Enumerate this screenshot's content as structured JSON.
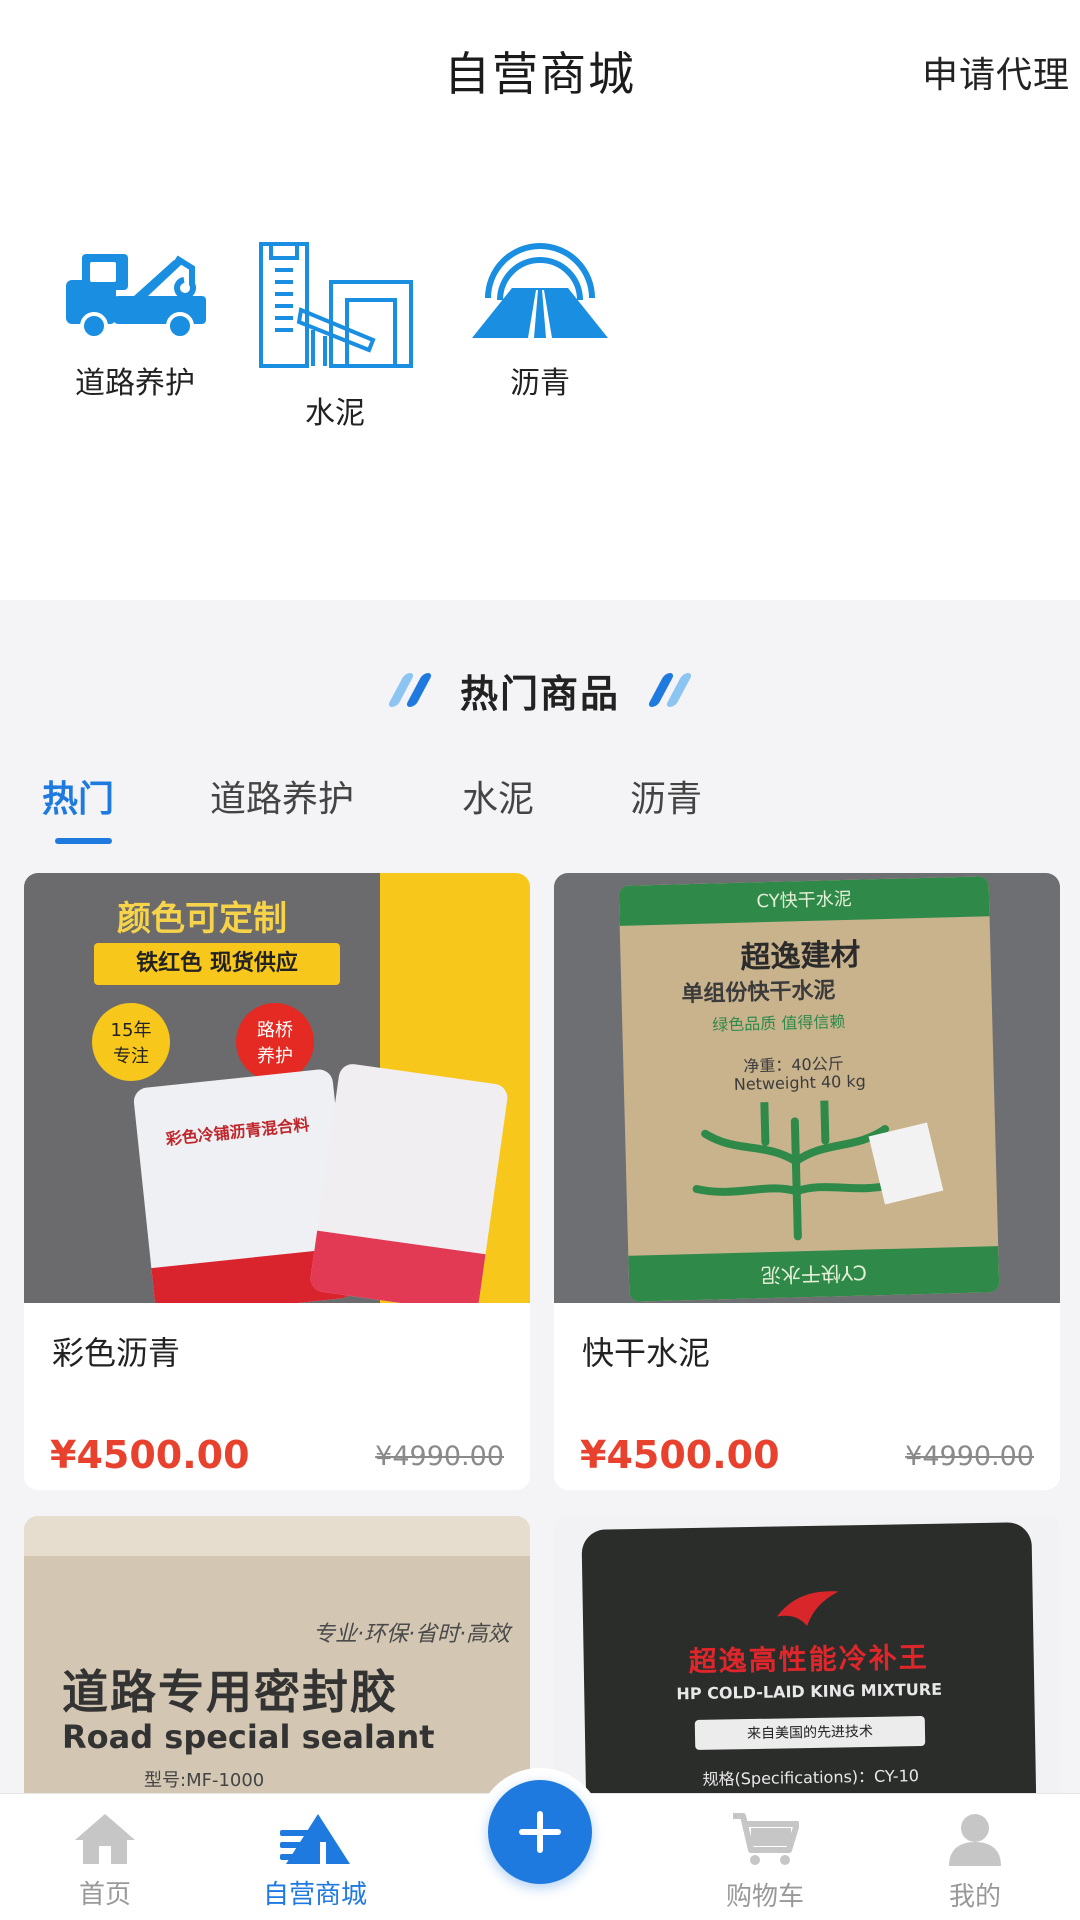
{
  "header": {
    "title": "自营商城",
    "agent_link": "申请代理"
  },
  "categories": [
    {
      "label": "道路养护",
      "icon": "tow-truck-icon"
    },
    {
      "label": "水泥",
      "icon": "cement-plant-icon"
    },
    {
      "label": "沥青",
      "icon": "road-tunnel-icon"
    }
  ],
  "section": {
    "title": "热门商品"
  },
  "tabs": [
    "热门",
    "道路养护",
    "水泥",
    "沥青"
  ],
  "active_tab": "热门",
  "products": [
    {
      "name": "彩色沥青",
      "price": "¥4500.00",
      "original_price": "¥4990.00",
      "image_text": {
        "headline": "颜色可定制",
        "strip": "铁红色 现货供应",
        "badge_left": "15年\n专注",
        "badge_right": "路桥\n养护",
        "bag": "彩色冷铺沥青混合料"
      }
    },
    {
      "name": "快干水泥",
      "price": "¥4500.00",
      "original_price": "¥4990.00",
      "image_text": {
        "top": "CY快干水泥",
        "brand": "超逸建材",
        "line1": "单组份快干水泥",
        "line2": "绿色品质 值得信赖",
        "line3": "净重：40公斤",
        "line4": "Netweight 40 kg",
        "bottom": "CY快干水泥"
      }
    },
    {
      "name": "",
      "image_text": {
        "slogan": "专业·环保·省时·高效",
        "cn": "道路专用密封胶",
        "en": "Road special sealant",
        "model": "型号:MF-1000"
      }
    },
    {
      "name": "",
      "image_text": {
        "cn": "超逸高性能冷补王",
        "en": "HP COLD-LAID KING MIXTURE",
        "sub": "来自美国的先进技术",
        "spec": "规格(Specifications)：CY-10"
      }
    }
  ],
  "nav": [
    {
      "label": "首页",
      "icon": "home-icon"
    },
    {
      "label": "自营商城",
      "icon": "mall-icon"
    },
    {
      "label": "",
      "icon": "plus-icon"
    },
    {
      "label": "购物车",
      "icon": "cart-icon"
    },
    {
      "label": "我的",
      "icon": "user-icon"
    }
  ],
  "colors": {
    "accent": "#1f7ae0",
    "price": "#e8412e",
    "icon_blue": "#1a8ee0"
  }
}
